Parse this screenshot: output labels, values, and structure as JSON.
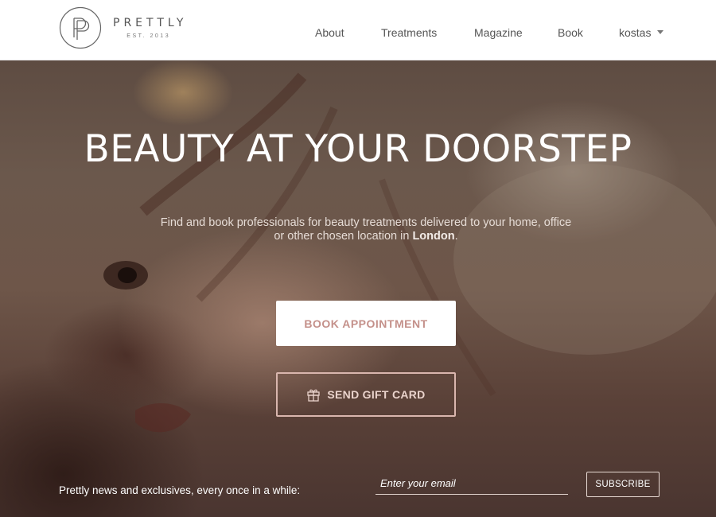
{
  "header": {
    "logo_name": "PRETTLY",
    "logo_est": "EST. 2013",
    "nav": [
      {
        "label": "About"
      },
      {
        "label": "Treatments"
      },
      {
        "label": "Magazine"
      },
      {
        "label": "Book"
      },
      {
        "label": "kostas"
      }
    ]
  },
  "hero": {
    "title": "BEAUTY AT YOUR DOORSTEP",
    "description_pre": "Find and book professionals for beauty treatments delivered to your home, office or other chosen location in ",
    "description_city": "London",
    "description_post": ".",
    "book_button": "BOOK APPOINTMENT",
    "gift_button": "SEND GIFT CARD"
  },
  "newsletter": {
    "label": "Prettly news and exclusives, every once in a while:",
    "email_placeholder": "Enter your email",
    "subscribe_button": "SUBSCRIBE"
  },
  "colors": {
    "accent": "#c4908a",
    "header_bg": "#ffffff",
    "nav_text": "#555555"
  },
  "icons": [
    "prettly-logo-icon",
    "chevron-down-icon",
    "gift-icon"
  ]
}
